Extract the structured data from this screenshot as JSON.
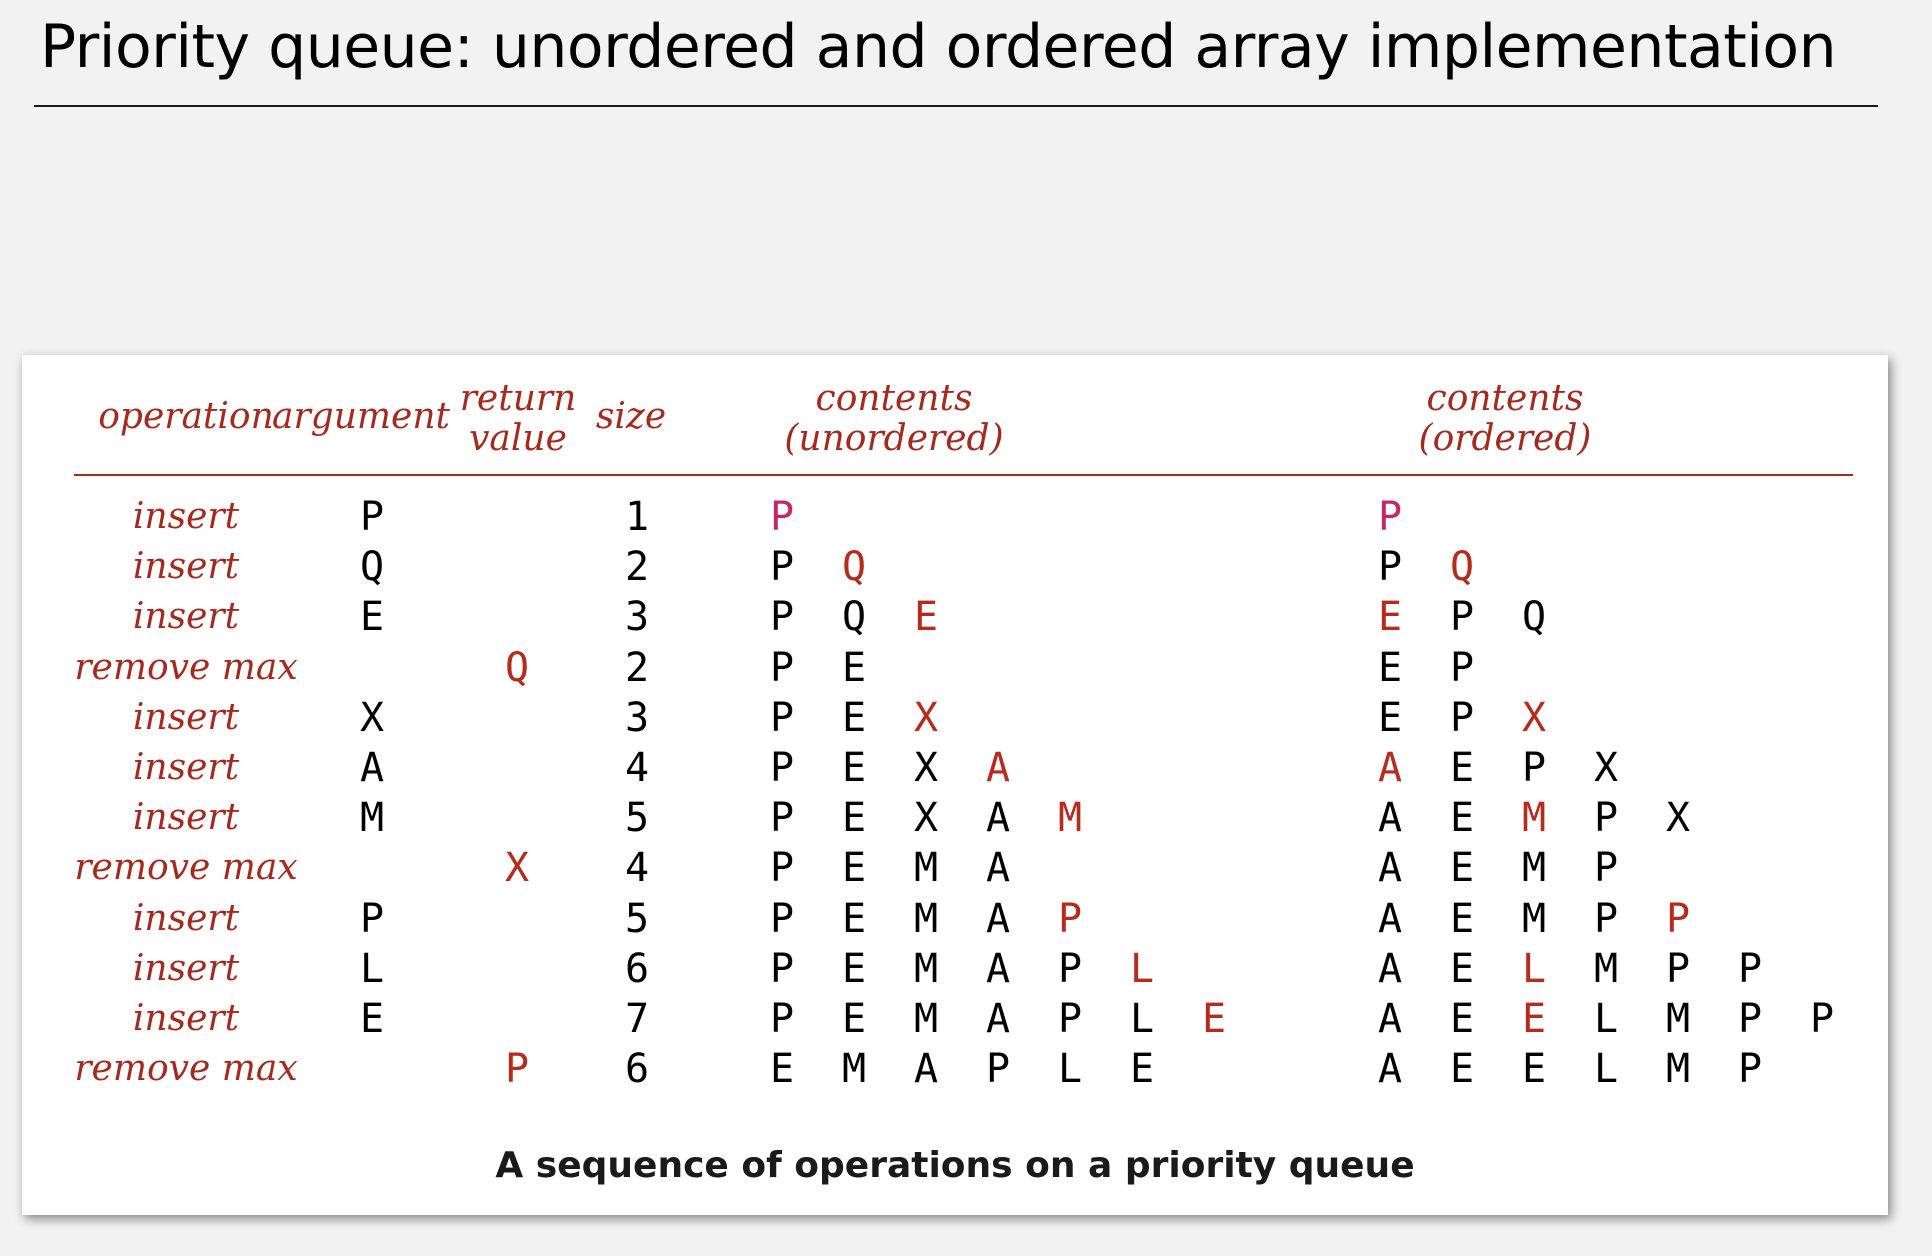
{
  "title": "Priority queue:  unordered and ordered array implementation",
  "colors": {
    "accent": "#a52a1e",
    "new_item": "#b52b1c",
    "first_item": "#c4266a"
  },
  "table": {
    "headers": {
      "operation": "operation",
      "argument": "argument",
      "return_value_line1": "return",
      "return_value_line2": "value",
      "size": "size",
      "unordered_line1": "contents",
      "unordered_line2": "(unordered)",
      "ordered_line1": "contents",
      "ordered_line2": "(ordered)"
    },
    "rows": [
      {
        "op": "insert",
        "arg": "P",
        "ret": "",
        "size": "1",
        "unordered": [
          "P"
        ],
        "unordered_hl": 0,
        "ordered": [
          "P"
        ],
        "ordered_hl": 0
      },
      {
        "op": "insert",
        "arg": "Q",
        "ret": "",
        "size": "2",
        "unordered": [
          "P",
          "Q"
        ],
        "unordered_hl": 1,
        "ordered": [
          "P",
          "Q"
        ],
        "ordered_hl": 1
      },
      {
        "op": "insert",
        "arg": "E",
        "ret": "",
        "size": "3",
        "unordered": [
          "P",
          "Q",
          "E"
        ],
        "unordered_hl": 2,
        "ordered": [
          "E",
          "P",
          "Q"
        ],
        "ordered_hl": 0
      },
      {
        "op": "remove max",
        "arg": "",
        "ret": "Q",
        "size": "2",
        "unordered": [
          "P",
          "E"
        ],
        "unordered_hl": -1,
        "ordered": [
          "E",
          "P"
        ],
        "ordered_hl": -1
      },
      {
        "op": "insert",
        "arg": "X",
        "ret": "",
        "size": "3",
        "unordered": [
          "P",
          "E",
          "X"
        ],
        "unordered_hl": 2,
        "ordered": [
          "E",
          "P",
          "X"
        ],
        "ordered_hl": 2
      },
      {
        "op": "insert",
        "arg": "A",
        "ret": "",
        "size": "4",
        "unordered": [
          "P",
          "E",
          "X",
          "A"
        ],
        "unordered_hl": 3,
        "ordered": [
          "A",
          "E",
          "P",
          "X"
        ],
        "ordered_hl": 0
      },
      {
        "op": "insert",
        "arg": "M",
        "ret": "",
        "size": "5",
        "unordered": [
          "P",
          "E",
          "X",
          "A",
          "M"
        ],
        "unordered_hl": 4,
        "ordered": [
          "A",
          "E",
          "M",
          "P",
          "X"
        ],
        "ordered_hl": 2
      },
      {
        "op": "remove max",
        "arg": "",
        "ret": "X",
        "size": "4",
        "unordered": [
          "P",
          "E",
          "M",
          "A"
        ],
        "unordered_hl": -1,
        "ordered": [
          "A",
          "E",
          "M",
          "P"
        ],
        "ordered_hl": -1
      },
      {
        "op": "insert",
        "arg": "P",
        "ret": "",
        "size": "5",
        "unordered": [
          "P",
          "E",
          "M",
          "A",
          "P"
        ],
        "unordered_hl": 4,
        "ordered": [
          "A",
          "E",
          "M",
          "P",
          "P"
        ],
        "ordered_hl": 4
      },
      {
        "op": "insert",
        "arg": "L",
        "ret": "",
        "size": "6",
        "unordered": [
          "P",
          "E",
          "M",
          "A",
          "P",
          "L"
        ],
        "unordered_hl": 5,
        "ordered": [
          "A",
          "E",
          "L",
          "M",
          "P",
          "P"
        ],
        "ordered_hl": 2
      },
      {
        "op": "insert",
        "arg": "E",
        "ret": "",
        "size": "7",
        "unordered": [
          "P",
          "E",
          "M",
          "A",
          "P",
          "L",
          "E"
        ],
        "unordered_hl": 6,
        "ordered": [
          "A",
          "E",
          "E",
          "L",
          "M",
          "P",
          "P"
        ],
        "ordered_hl": 2
      },
      {
        "op": "remove max",
        "arg": "",
        "ret": "P",
        "size": "6",
        "unordered": [
          "E",
          "M",
          "A",
          "P",
          "L",
          "E"
        ],
        "unordered_hl": -1,
        "ordered": [
          "A",
          "E",
          "E",
          "L",
          "M",
          "P"
        ],
        "ordered_hl": -1
      }
    ]
  },
  "caption": "A sequence of operations on a priority queue"
}
